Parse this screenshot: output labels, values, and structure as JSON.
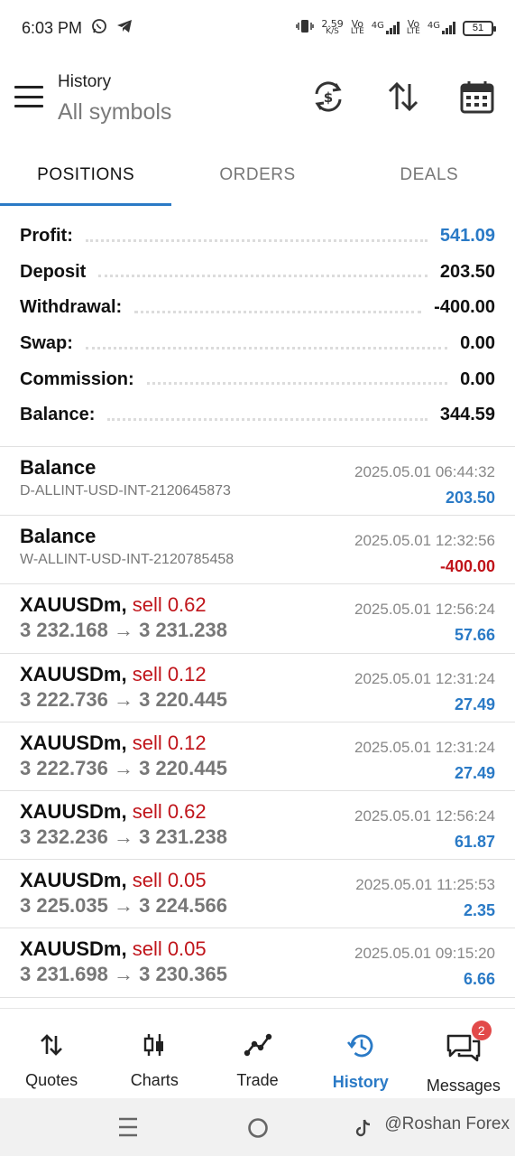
{
  "status_bar": {
    "time": "6:03 PM",
    "net_speed": "2.59",
    "net_speed_unit": "K/S",
    "sim1_top": "Vo",
    "sim1_bottom": "LTE",
    "sim1_gen": "4G",
    "sim2_top": "Vo",
    "sim2_bottom": "LTE",
    "sim2_gen": "4G",
    "battery": "51"
  },
  "header": {
    "title": "History",
    "subtitle": "All symbols"
  },
  "tabs": [
    {
      "label": "POSITIONS",
      "active": true
    },
    {
      "label": "ORDERS",
      "active": false
    },
    {
      "label": "DEALS",
      "active": false
    }
  ],
  "summary": [
    {
      "label": "Profit:",
      "value": "541.09"
    },
    {
      "label": "Deposit",
      "value": "203.50"
    },
    {
      "label": "Withdrawal:",
      "value": "-400.00"
    },
    {
      "label": "Swap:",
      "value": "0.00"
    },
    {
      "label": "Commission:",
      "value": "0.00"
    },
    {
      "label": "Balance:",
      "value": "344.59"
    }
  ],
  "history": [
    {
      "title": "Balance",
      "detail": "D-ALLINT-USD-INT-2120645873",
      "date": "2025.05.01 06:44:32",
      "amount": "203.50"
    },
    {
      "title": "Balance",
      "detail": "W-ALLINT-USD-INT-2120785458",
      "date": "2025.05.01 12:32:56",
      "amount": "-400.00"
    },
    {
      "symbol": "XAUUSDm,",
      "side": "sell 0.62",
      "prices": "3 232.168 → 3 231.238",
      "date": "2025.05.01 12:56:24",
      "amount": "57.66"
    },
    {
      "symbol": "XAUUSDm,",
      "side": "sell 0.12",
      "prices": "3 222.736 → 3 220.445",
      "date": "2025.05.01 12:31:24",
      "amount": "27.49"
    },
    {
      "symbol": "XAUUSDm,",
      "side": "sell 0.12",
      "prices": "3 222.736 → 3 220.445",
      "date": "2025.05.01 12:31:24",
      "amount": "27.49"
    },
    {
      "symbol": "XAUUSDm,",
      "side": "sell 0.62",
      "prices": "3 232.236 → 3 231.238",
      "date": "2025.05.01 12:56:24",
      "amount": "61.87"
    },
    {
      "symbol": "XAUUSDm,",
      "side": "sell 0.05",
      "prices": "3 225.035 → 3 224.566",
      "date": "2025.05.01 11:25:53",
      "amount": "2.35"
    },
    {
      "symbol": "XAUUSDm,",
      "side": "sell 0.05",
      "prices": "3 231.698 → 3 230.365",
      "date": "2025.05.01 09:15:20",
      "amount": "6.66"
    }
  ],
  "bottom_nav": [
    {
      "label": "Quotes",
      "icon": "updown-arrows-icon"
    },
    {
      "label": "Charts",
      "icon": "candlestick-icon"
    },
    {
      "label": "Trade",
      "icon": "trend-line-icon"
    },
    {
      "label": "History",
      "icon": "history-clock-icon",
      "active": true
    },
    {
      "label": "Messages",
      "icon": "chat-bubbles-icon",
      "badge": "2"
    }
  ],
  "watermark": "@Roshan Forex",
  "colors": {
    "accent": "#2a7ac6",
    "negative": "#c0141a",
    "badge": "#e24a4a"
  }
}
